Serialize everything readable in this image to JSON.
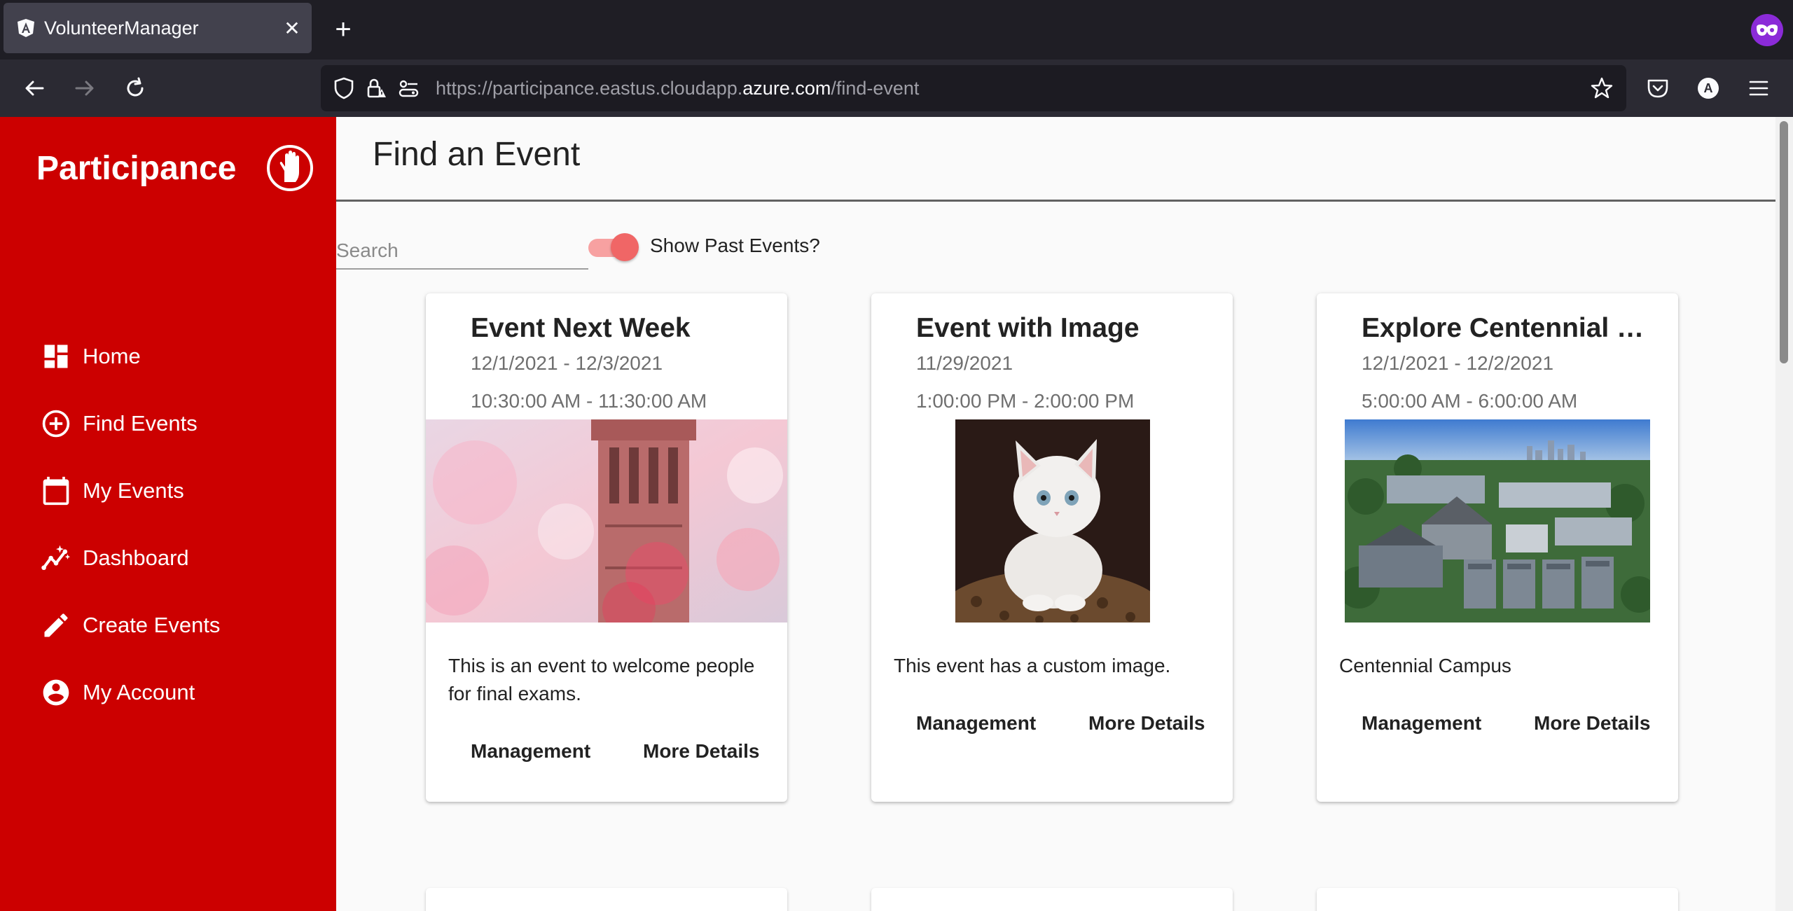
{
  "browser": {
    "tab_title": "VolunteerManager",
    "tab_close": "✕",
    "new_tab": "+",
    "url_prefix": "https://participance.eastus.cloudapp.",
    "url_domain": "azure.com",
    "url_path": "/find-event",
    "profile_initial": "A"
  },
  "sidebar": {
    "brand": "Participance",
    "items": [
      {
        "label": "Home",
        "icon": "dashboard-icon"
      },
      {
        "label": "Find Events",
        "icon": "add-circle-icon"
      },
      {
        "label": "My Events",
        "icon": "calendar-icon"
      },
      {
        "label": "Dashboard",
        "icon": "insights-icon"
      },
      {
        "label": "Create Events",
        "icon": "pencil-icon"
      },
      {
        "label": "My Account",
        "icon": "account-circle-icon"
      }
    ]
  },
  "main": {
    "title": "Find an Event",
    "search_placeholder": "Search",
    "toggle_label": "Show Past Events?",
    "toggle_on": true
  },
  "events": [
    {
      "title": "Event Next Week",
      "date": "12/1/2021 - 12/3/2021",
      "time": "10:30:00 AM - 11:30:00 AM",
      "description": "This is an event to welcome people for final exams.",
      "image": "bell-tower-photo",
      "management_label": "Management",
      "details_label": "More Details"
    },
    {
      "title": "Event with Image",
      "date": "11/29/2021",
      "time": "1:00:00 PM - 2:00:00 PM",
      "description": "This event has a custom image.",
      "image": "kitten-photo",
      "management_label": "Management",
      "details_label": "More Details"
    },
    {
      "title": "Explore Centennial Campus",
      "date": "12/1/2021 - 12/2/2021",
      "time": "5:00:00 AM - 6:00:00 AM",
      "description": "Centennial Campus",
      "image": "campus-aerial-photo",
      "management_label": "Management",
      "details_label": "More Details"
    }
  ],
  "colors": {
    "brand_red": "#cc0000",
    "toggle_thumb": "#f06666",
    "toggle_track": "#f7a1a1"
  }
}
